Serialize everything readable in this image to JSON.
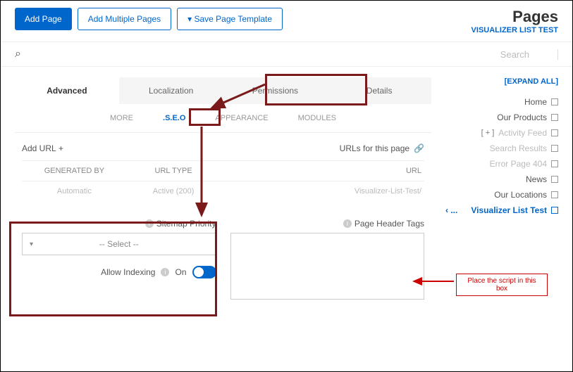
{
  "header": {
    "title": "Pages",
    "subtitle": "VISUALIZER LIST TEST",
    "add_page": "Add Page",
    "add_multiple": "Add Multiple Pages",
    "save_template": "Save Page Template"
  },
  "search": {
    "placeholder": "Search"
  },
  "sidebar": {
    "expand_all": "[EXPAND ALL]",
    "expand_sym": "[ + ]",
    "chevron": "...  ›",
    "items": [
      {
        "label": "Home",
        "dim": false
      },
      {
        "label": "Our Products",
        "dim": false
      },
      {
        "label": "Activity Feed",
        "dim": true
      },
      {
        "label": "Search Results",
        "dim": true
      },
      {
        "label": "404 Error Page",
        "dim": true
      },
      {
        "label": "News",
        "dim": false
      },
      {
        "label": "Our Locations",
        "dim": false
      },
      {
        "label": "Visualizer List Test",
        "dim": false,
        "selected": true
      }
    ]
  },
  "tabs_main": [
    {
      "label": "Details"
    },
    {
      "label": "Permissions"
    },
    {
      "label": "Localization"
    },
    {
      "label": "Advanced",
      "active": true
    }
  ],
  "tabs_sub": [
    {
      "label": "MODULES"
    },
    {
      "label": "APPEARANCE"
    },
    {
      "label": "S.E.O.",
      "active": true
    },
    {
      "label": "MORE"
    }
  ],
  "urls": {
    "title": "URLs for this page",
    "add_url": "+ Add URL",
    "headers": {
      "url": "URL",
      "type": "URL TYPE",
      "gen": "GENERATED BY"
    },
    "row": {
      "url": "/Visualizer-List-Test",
      "type": "Active (200)",
      "gen": "Automatic"
    }
  },
  "form": {
    "header_tags": "Page Header Tags",
    "sitemap_priority": "Sitemap Priority",
    "select_placeholder": "-- Select --",
    "allow_indexing": "Allow Indexing",
    "on": "On"
  },
  "annotation": {
    "text": "Place the script in this box"
  }
}
